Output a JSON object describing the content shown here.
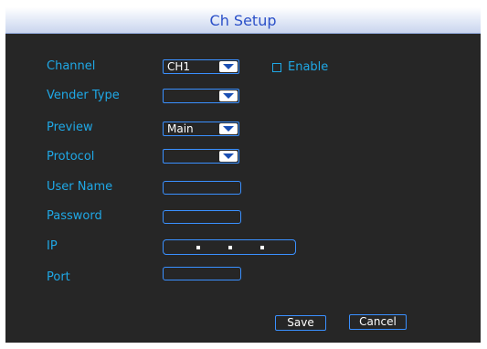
{
  "window": {
    "title": "Ch Setup"
  },
  "form": {
    "channel": {
      "label": "Channel",
      "value": "CH1"
    },
    "enable": {
      "label": "Enable",
      "checked": false
    },
    "vender_type": {
      "label": "Vender Type",
      "value": ""
    },
    "preview": {
      "label": "Preview",
      "value": "Main"
    },
    "protocol": {
      "label": "Protocol",
      "value": ""
    },
    "user_name": {
      "label": "User Name",
      "value": ""
    },
    "password": {
      "label": "Password",
      "value": ""
    },
    "ip": {
      "label": "IP",
      "value": ""
    },
    "port": {
      "label": "Port",
      "value": ""
    }
  },
  "buttons": {
    "save": "Save",
    "cancel": "Cancel"
  },
  "colors": {
    "title_text": "#2b50c8",
    "label_text": "#1fa8e6",
    "field_border": "#3a90ff",
    "panel_bg": "#262626"
  }
}
